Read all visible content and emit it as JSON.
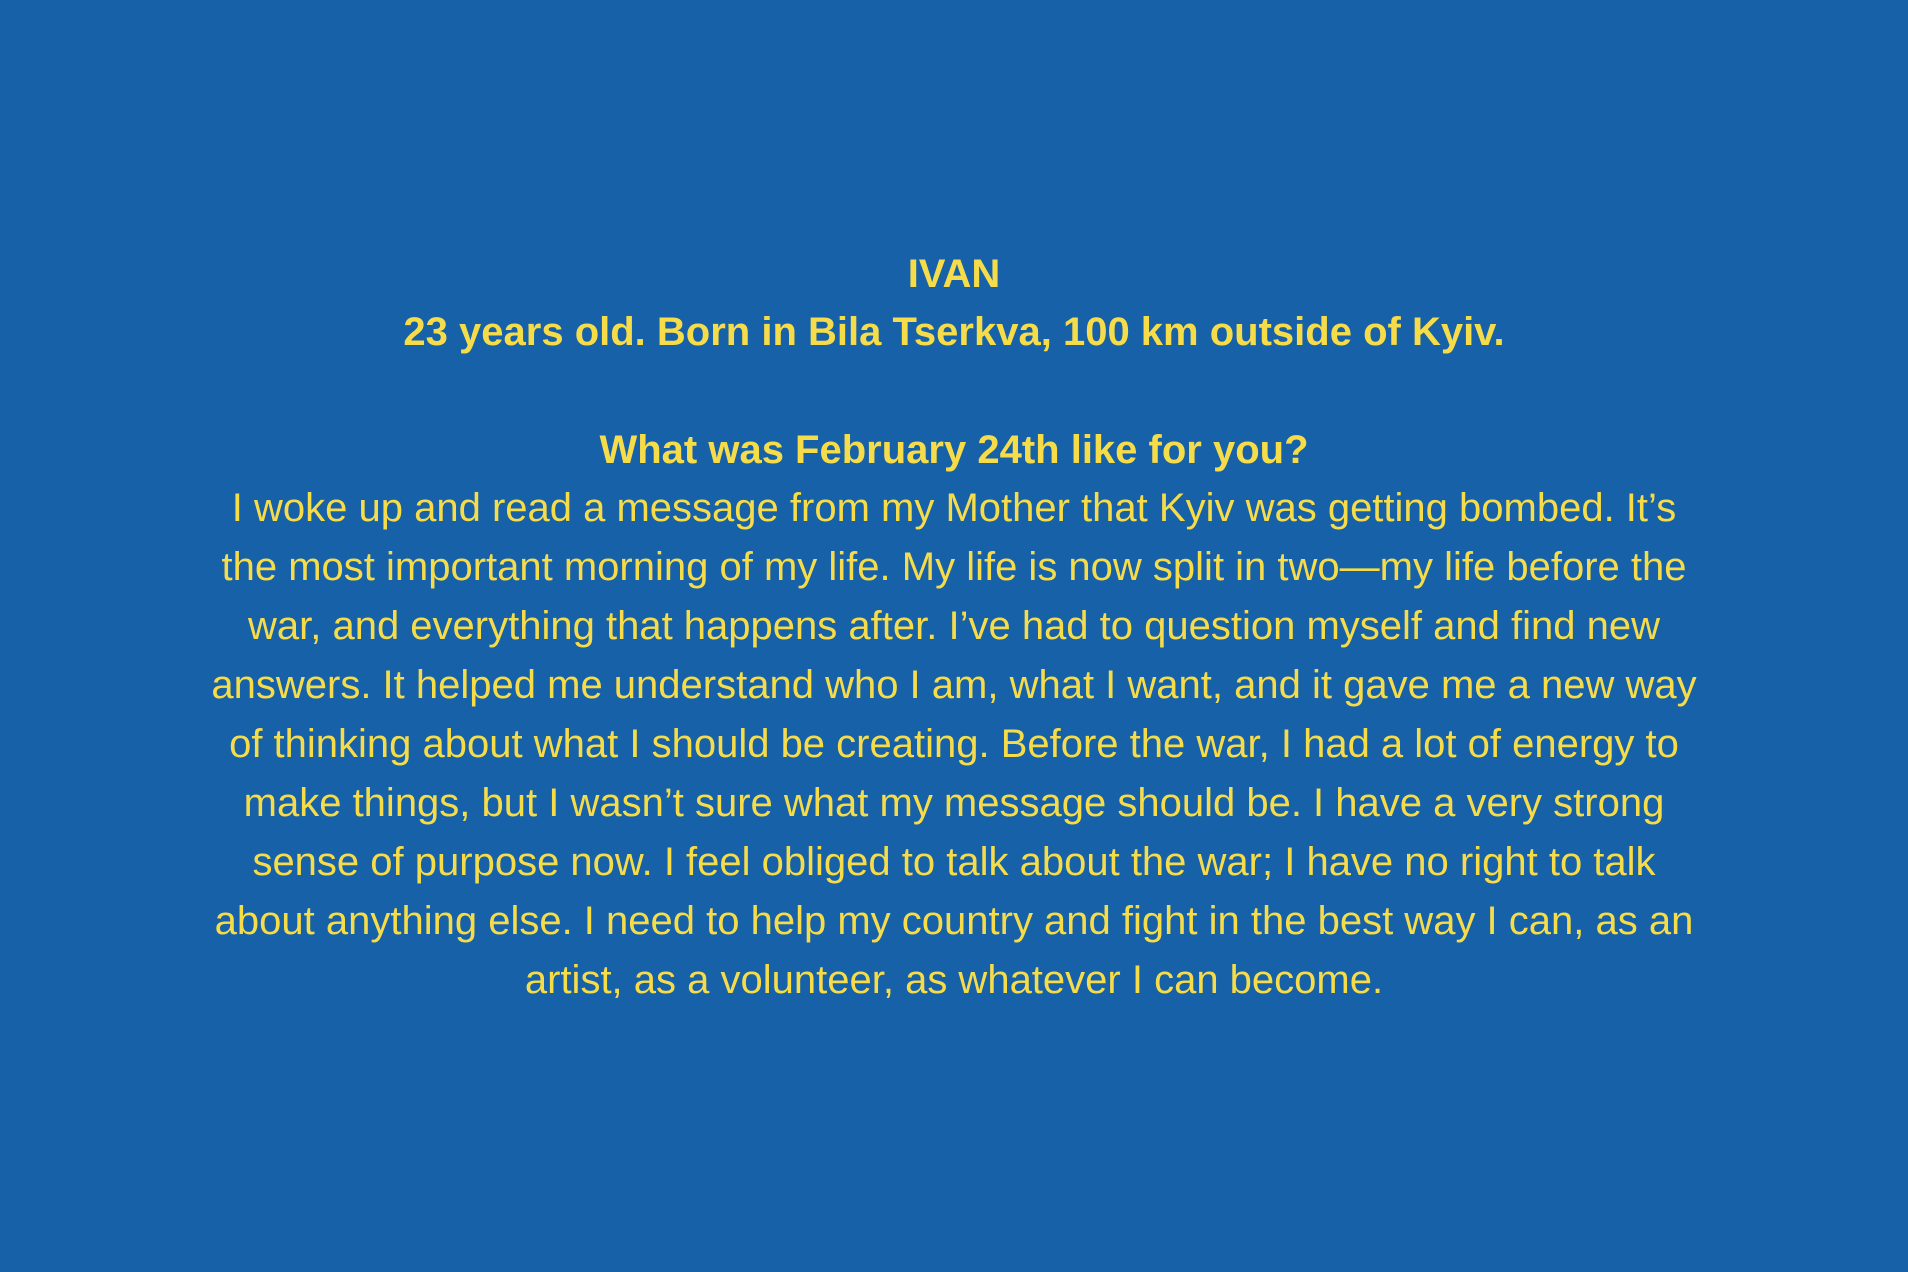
{
  "profile": {
    "name": "IVAN",
    "bio": "23 years old. Born in Bila Tserkva, 100 km outside of Kyiv."
  },
  "interview": {
    "question": "What was February 24th like for you?",
    "answer_lines": [
      "I woke up and read a message from my Mother that Kyiv was getting bombed. It’s",
      "the most important morning of my life. My life is now split in two—my life before the",
      "war, and everything that happens after. I’ve had to question myself and find new",
      "answers. It helped me understand who I am, what I want, and it gave me a new way",
      "of thinking about what I should be creating. Before the war, I had a lot of energy to",
      "make things, but I wasn’t sure what my message should be. I have a very strong",
      "sense of purpose now. I feel obliged to talk about the war; I have no right to talk",
      "about anything else. I need to help my country and fight in the best way I can, as an",
      "artist, as a volunteer, as whatever I can become."
    ]
  },
  "colors": {
    "background": "#1661a7",
    "text": "#f7dc4a"
  }
}
